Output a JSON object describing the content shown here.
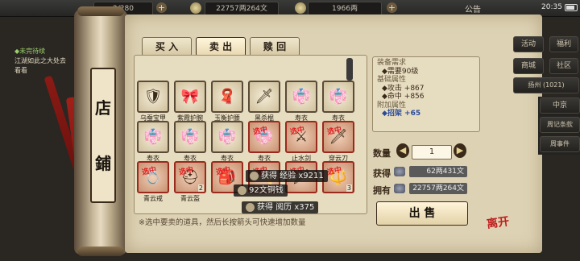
{
  "topbar": {
    "res1": "2/280",
    "res2": "22757两264文",
    "res3": "1966两",
    "notice": "公告",
    "time": "20:35"
  },
  "quest": {
    "title": "◆未完待续",
    "text": "江湖如此之大处去看看"
  },
  "shop_sign": [
    "店",
    "鋪"
  ],
  "tabs": [
    "买 入",
    "卖 出",
    "赎 回"
  ],
  "items": [
    {
      "name": "乌蚕宝甲",
      "glyph": "🛡",
      "selected": false,
      "count": ""
    },
    {
      "name": "紫霞护腕",
      "glyph": "🎀",
      "selected": false,
      "count": ""
    },
    {
      "name": "玉衡护腰",
      "glyph": "🧣",
      "selected": false,
      "count": ""
    },
    {
      "name": "黑杀棍",
      "glyph": "🗡",
      "selected": false,
      "count": ""
    },
    {
      "name": "寿衣",
      "glyph": "👘",
      "selected": false,
      "count": ""
    },
    {
      "name": "寿衣",
      "glyph": "👘",
      "selected": false,
      "count": ""
    },
    {
      "name": "寿衣",
      "glyph": "👘",
      "selected": false,
      "count": ""
    },
    {
      "name": "寿衣",
      "glyph": "👘",
      "selected": false,
      "count": ""
    },
    {
      "name": "寿衣",
      "glyph": "👘",
      "selected": false,
      "count": ""
    },
    {
      "name": "寿衣",
      "glyph": "👘",
      "selected": true,
      "count": ""
    },
    {
      "name": "止水剑",
      "glyph": "⚔",
      "selected": true,
      "count": ""
    },
    {
      "name": "穿云刀",
      "glyph": "🗡",
      "selected": true,
      "count": ""
    },
    {
      "name": "青云戒",
      "glyph": "💍",
      "selected": true,
      "count": ""
    },
    {
      "name": "青云盔",
      "glyph": "⛑",
      "selected": true,
      "count": "2"
    },
    {
      "name": "",
      "glyph": "🎒",
      "selected": true,
      "count": ""
    },
    {
      "name": "",
      "glyph": "🪓",
      "selected": true,
      "count": ""
    },
    {
      "name": "",
      "glyph": "🗡",
      "selected": true,
      "count": ""
    },
    {
      "name": "",
      "glyph": "🔱",
      "selected": true,
      "count": "3"
    }
  ],
  "hint": "※选中要卖的道具，然后长按箭头可快速增加数量",
  "stats": {
    "req_title": "装备需求",
    "req": "◆需要90级",
    "base_title": "基础属性",
    "atk": "◆攻击 +867",
    "hit": "◆命中 +856",
    "extra_title": "附加属性",
    "block": "◆招架 +65"
  },
  "quantity_label": "数量",
  "quantity": "1",
  "gain_label": "获得",
  "gain": "62两431文",
  "own_label": "拥有",
  "own": "22757两264文",
  "sell_button": "出 售",
  "menu": {
    "activity": "活动",
    "welfare": "福利",
    "shop": "商城",
    "society": "社区",
    "region": "扬州",
    "coords": "(1021)",
    "city": "中京",
    "weekly": "周记条款",
    "events": "周事件"
  },
  "toasts": {
    "exp": "获得 经验 x9211",
    "coin": "92文铜钱",
    "xp2": "获得 阅历 x375"
  },
  "stamp": "选中",
  "exit": "离开"
}
